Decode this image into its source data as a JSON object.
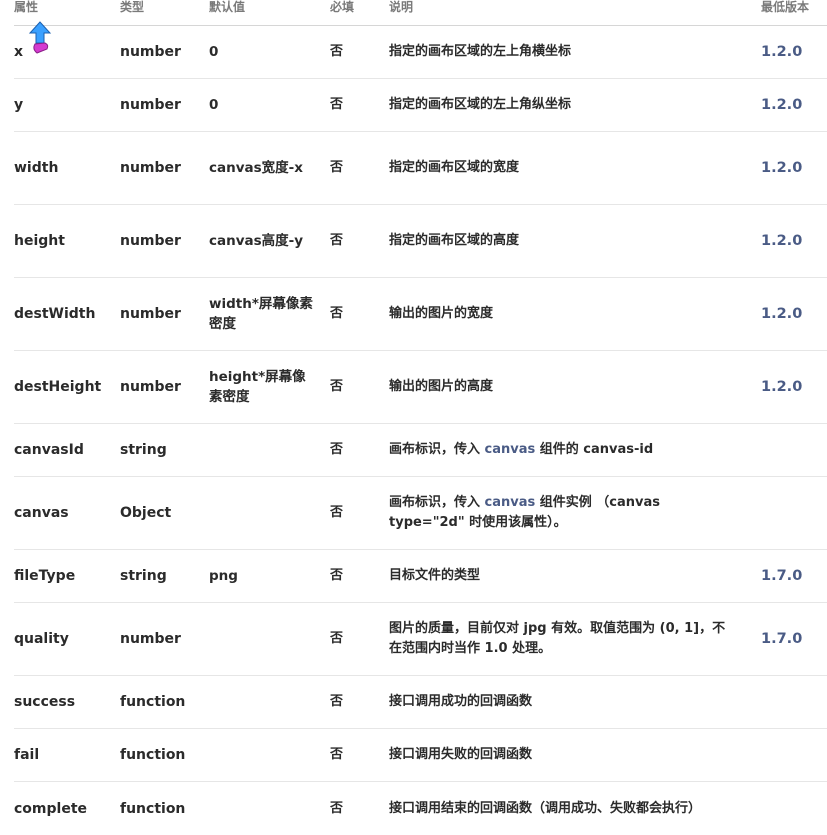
{
  "headers": {
    "prop": "属性",
    "type": "类型",
    "default": "默认值",
    "required": "必填",
    "desc": "说明",
    "version": "最低版本"
  },
  "rows": [
    {
      "prop": "x",
      "type": "number",
      "default": "0",
      "required": "否",
      "desc": "指定的画布区域的左上角横坐标",
      "version": "1.2.0"
    },
    {
      "prop": "y",
      "type": "number",
      "default": "0",
      "required": "否",
      "desc": "指定的画布区域的左上角纵坐标",
      "version": "1.2.0"
    },
    {
      "prop": "width",
      "type": "number",
      "default": "canvas宽度-x",
      "required": "否",
      "desc": "指定的画布区域的宽度",
      "version": "1.2.0"
    },
    {
      "prop": "height",
      "type": "number",
      "default": "canvas高度-y",
      "required": "否",
      "desc": "指定的画布区域的高度",
      "version": "1.2.0"
    },
    {
      "prop": "destWidth",
      "type": "number",
      "default": "width*屏幕像素密度",
      "required": "否",
      "desc": "输出的图片的宽度",
      "version": "1.2.0"
    },
    {
      "prop": "destHeight",
      "type": "number",
      "default": "height*屏幕像素密度",
      "required": "否",
      "desc": "输出的图片的高度",
      "version": "1.2.0"
    },
    {
      "prop": "canvasId",
      "type": "string",
      "default": "",
      "required": "否",
      "desc_pre": "画布标识，传入 ",
      "desc_link": "canvas",
      "desc_post": " 组件的 canvas-id",
      "version": ""
    },
    {
      "prop": "canvas",
      "type": "Object",
      "default": "",
      "required": "否",
      "desc_pre": "画布标识，传入 ",
      "desc_link": "canvas",
      "desc_post": " 组件实例 （canvas type=\"2d\" 时使用该属性）。",
      "version": ""
    },
    {
      "prop": "fileType",
      "type": "string",
      "default": "png",
      "required": "否",
      "desc": "目标文件的类型",
      "version": "1.7.0"
    },
    {
      "prop": "quality",
      "type": "number",
      "default": "",
      "required": "否",
      "desc": "图片的质量，目前仅对 jpg 有效。取值范围为 (0, 1]，不在范围内时当作 1.0 处理。",
      "version": "1.7.0"
    },
    {
      "prop": "success",
      "type": "function",
      "default": "",
      "required": "否",
      "desc": "接口调用成功的回调函数",
      "version": ""
    },
    {
      "prop": "fail",
      "type": "function",
      "default": "",
      "required": "否",
      "desc": "接口调用失败的回调函数",
      "version": ""
    },
    {
      "prop": "complete",
      "type": "function",
      "default": "",
      "required": "否",
      "desc": "接口调用结束的回调函数（调用成功、失败都会执行）",
      "version": ""
    }
  ]
}
